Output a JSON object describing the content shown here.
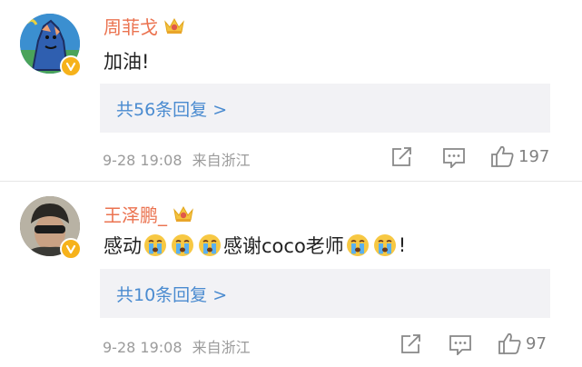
{
  "comments": [
    {
      "username": "周菲戈",
      "text": "加油!",
      "reply_link": "共56条回复 >",
      "date": "9-28 19:08",
      "source": "来自浙江",
      "likes": "197",
      "icons": {
        "avatar": "avatar-illustration-blue",
        "badge": "verified-badge-icon",
        "crown": "crown-icon",
        "share": "share-icon",
        "comment": "comment-icon",
        "like": "thumbs-up-icon"
      }
    },
    {
      "username": "王泽鹏_",
      "text_before": "感动",
      "text_middle": "感谢coco老师",
      "text_after": "!",
      "reply_link": "共10条回复 >",
      "date": "9-28 19:08",
      "source": "来自浙江",
      "likes": "97",
      "icons": {
        "avatar": "avatar-photo",
        "badge": "verified-badge-icon",
        "crown": "crown-icon",
        "emoji": "crying-face-emoji",
        "share": "share-icon",
        "comment": "comment-icon",
        "like": "thumbs-up-icon"
      }
    }
  ],
  "colors": {
    "username": "#eb7350",
    "reply_link": "#4a8bd0",
    "reply_bg": "#f2f2f5",
    "meta": "#9b9b9b",
    "badge": "#f6b21b"
  }
}
